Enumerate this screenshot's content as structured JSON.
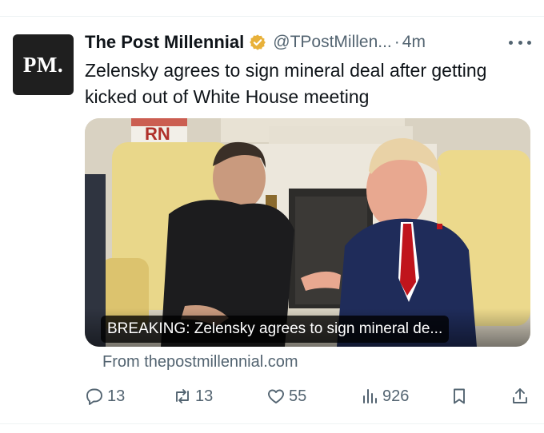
{
  "tweet": {
    "display_name": "The Post Millennial",
    "handle": "@TPostMillen...",
    "separator": "·",
    "time": "4m",
    "avatar_text": "PM.",
    "text": "Zelensky agrees to sign mineral deal after getting kicked out of White House meeting",
    "media": {
      "caption": "BREAKING: Zelensky agrees to sign mineral de...",
      "flag_text": "RN"
    },
    "source": "From thepostmillennial.com",
    "actions": {
      "replies": "13",
      "reposts": "13",
      "likes": "55",
      "views": "926"
    },
    "icons": {
      "verified": "verified-gold-badge-icon",
      "more": "more-dots-icon",
      "reply": "reply-bubble-icon",
      "repost": "repost-arrows-icon",
      "like": "heart-icon",
      "views": "views-bars-icon",
      "bookmark": "bookmark-icon",
      "share": "share-upload-icon"
    },
    "colors": {
      "verified_gold": "#e8b13a",
      "secondary_text": "#536471",
      "avatar_bg": "#1f1f1f"
    }
  }
}
